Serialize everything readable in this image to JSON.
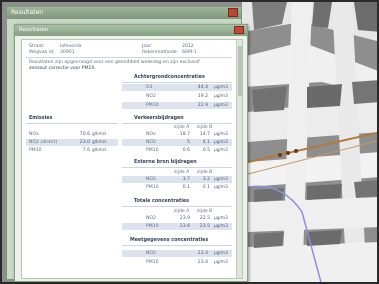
{
  "colors": {
    "window_green": "#86a082",
    "close_red": "#c04a36",
    "highlight_row": "#dde3ee",
    "route_orange": "#b27a3a",
    "route_blue": "#8a8fe0"
  },
  "bg_window": {
    "title": "Resultaten"
  },
  "window": {
    "title": "Resultaten"
  },
  "meta": {
    "row1": {
      "label": "Straat:",
      "value": "lafeverda",
      "label2": "Jaar:",
      "value2": "2012"
    },
    "row2": {
      "label": "Wegvak id:",
      "value": "30901",
      "label2": "Rekenmethode:",
      "value2": "SRM-1"
    }
  },
  "intro": {
    "line1": "Resultaten zijn opgevraagd voor een gemiddeld weekdag en zijn exclusief",
    "line2": "zeezout correctie voor PM10."
  },
  "sections": {
    "achtergrond": {
      "title": "Achtergrondconcentraties",
      "rows": [
        {
          "label": "O3",
          "value": "44.4",
          "unit": "µg/m3"
        },
        {
          "label": "NO2",
          "value": "19.2",
          "unit": "µg/m3"
        },
        {
          "label": "PM10",
          "value": "22.9",
          "unit": "µg/m3"
        }
      ]
    },
    "emissies": {
      "title": "Emissies",
      "rows": [
        {
          "label": "NOx",
          "value": "70.6",
          "unit": "g/km/s"
        },
        {
          "label": "NO2 (direct)",
          "value": "23.0",
          "unit": "g/km/s"
        },
        {
          "label": "PM10",
          "value": "7.6",
          "unit": "g/km/s"
        }
      ]
    },
    "verkeer": {
      "title": "Verkeersbijdragen",
      "col_a": "zijde A",
      "col_b": "zijde B",
      "rows": [
        {
          "label": "NOx",
          "a": "18.7",
          "b": "14.7",
          "unit": "µg/m3"
        },
        {
          "label": "NO2",
          "a": "5",
          "b": "4.1",
          "unit": "µg/m3"
        },
        {
          "label": "PM10",
          "a": "0.6",
          "b": "0.5",
          "unit": "µg/m3"
        }
      ]
    },
    "extern": {
      "title": "Externe bron bijdragen",
      "col_a": "zijde A",
      "col_b": "zijde B",
      "rows": [
        {
          "label": "NO2",
          "a": "3.7",
          "b": "3.2",
          "unit": "µg/m3"
        },
        {
          "label": "PM10",
          "a": "0.1",
          "b": "0.1",
          "unit": "µg/m3"
        }
      ]
    },
    "totaal": {
      "title": "Totale concentraties",
      "col_a": "zijde A",
      "col_b": "zijde B",
      "rows": [
        {
          "label": "NO2",
          "a": "23.9",
          "b": "22.5",
          "unit": "µg/m3"
        },
        {
          "label": "PM10",
          "a": "23.6",
          "b": "23.5",
          "unit": "µg/m3"
        }
      ]
    },
    "meetgegevens": {
      "title": "Meetgegevens concentraties",
      "rows": [
        {
          "label": "NO2",
          "value": "23.4",
          "unit": "µg/m3"
        },
        {
          "label": "PM10",
          "value": "23.4",
          "unit": "µg/m3"
        }
      ]
    }
  }
}
